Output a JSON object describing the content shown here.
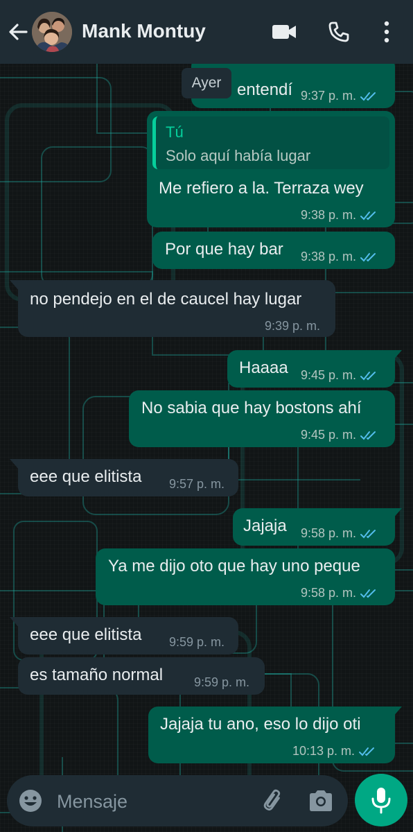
{
  "header": {
    "contact_name": "Mank Montuy"
  },
  "date_chip": "Ayer",
  "messages": [
    {
      "dir": "out",
      "text": "entendí",
      "time": "9:37 p. m.",
      "read": true
    },
    {
      "dir": "out",
      "quote_author": "Tú",
      "quote_text": "Solo aquí había lugar",
      "text": "Me refiero a la. Terraza wey",
      "time": "9:38 p. m.",
      "read": true
    },
    {
      "dir": "out",
      "text": "Por que hay bar",
      "time": "9:38 p. m.",
      "read": true
    },
    {
      "dir": "in",
      "text": "no pendejo en el de caucel hay lugar",
      "time": "9:39 p. m."
    },
    {
      "dir": "out",
      "text": "Haaaa",
      "time": "9:45 p. m.",
      "read": true
    },
    {
      "dir": "out",
      "text": "No sabia que hay bostons ahí",
      "time": "9:45 p. m.",
      "read": true
    },
    {
      "dir": "in",
      "text": "eee que elitista",
      "time": "9:57 p. m."
    },
    {
      "dir": "out",
      "text": "Jajaja",
      "time": "9:58 p. m.",
      "read": true
    },
    {
      "dir": "out",
      "text": "Ya me dijo oto que hay uno peque",
      "time": "9:58 p. m.",
      "read": true
    },
    {
      "dir": "in",
      "text": "eee que elitista",
      "time": "9:59 p. m."
    },
    {
      "dir": "in",
      "text": "es tamaño normal",
      "time": "9:59 p. m."
    },
    {
      "dir": "out",
      "text": "Jajaja tu ano, eso lo dijo oti",
      "time": "10:13 p. m.",
      "read": true
    }
  ],
  "input": {
    "placeholder": "Mensaje"
  },
  "colors": {
    "header_bg": "#1f2c34",
    "outgoing_bubble": "#005c4b",
    "incoming_bubble": "#1f2c34",
    "read_ticks": "#53bdeb",
    "mic_button": "#00a884"
  },
  "icons": [
    "back-arrow-icon",
    "video-call-icon",
    "phone-icon",
    "more-options-icon",
    "emoji-icon",
    "attach-icon",
    "camera-icon",
    "mic-icon"
  ]
}
